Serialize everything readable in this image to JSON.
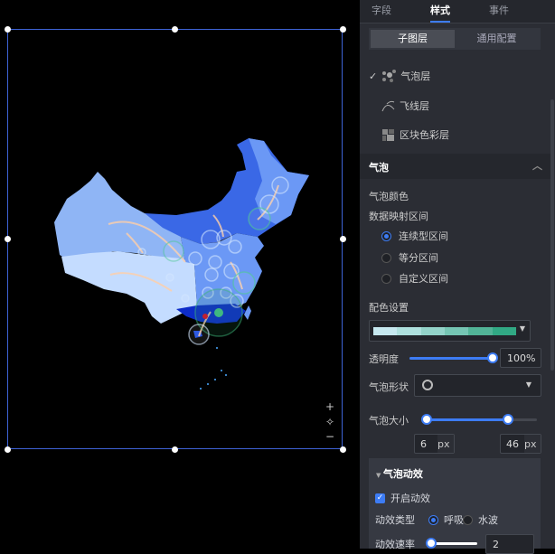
{
  "tabs": [
    {
      "label": "字段"
    },
    {
      "label": "样式"
    },
    {
      "label": "事件"
    }
  ],
  "segmented": {
    "options": [
      "子图层",
      "通用配置"
    ],
    "active": "子图层"
  },
  "layers": [
    {
      "label": "气泡层",
      "checked": true,
      "icon": "bubble-icon"
    },
    {
      "label": "飞线层",
      "checked": false,
      "icon": "flyline-icon"
    },
    {
      "label": "区块色彩层",
      "checked": false,
      "icon": "block-color-icon"
    }
  ],
  "check_mark": "✓",
  "section": {
    "title": "气泡"
  },
  "bubble_color": {
    "label": "气泡颜色",
    "mapping_label": "数据映射区间",
    "options": [
      "连续型区间",
      "等分区间",
      "自定义区间"
    ],
    "selected": "连续型区间"
  },
  "color_setting": {
    "label": "配色设置",
    "gradient": [
      "#c6e8ef",
      "#aee0dd",
      "#93d3c9",
      "#75c5b3",
      "#52b497",
      "#31a984"
    ]
  },
  "opacity": {
    "label": "透明度",
    "value": "100%",
    "fraction": 1.0
  },
  "shape": {
    "label": "气泡形状"
  },
  "size": {
    "label": "气泡大小",
    "min": "6",
    "max": "46",
    "unit": "px",
    "range_fraction": [
      0,
      0.75
    ]
  },
  "animation": {
    "title": "气泡动效",
    "enable_label": "开启动效",
    "enabled": true,
    "type_label": "动效类型",
    "types": [
      "呼吸",
      "水波"
    ],
    "selected_type": "呼吸",
    "rate_label": "动效速率",
    "rate": "2"
  },
  "map_controls": {
    "zoom_in": "+",
    "locate": "✧",
    "zoom_out": "−"
  },
  "colors": {
    "accent": "#3d7cf4",
    "selection": "#3e63d6"
  }
}
